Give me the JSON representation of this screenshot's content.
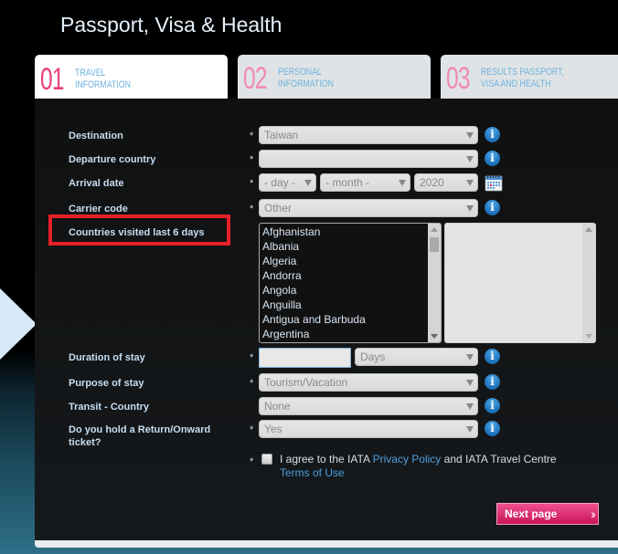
{
  "page": {
    "title": "Passport, Visa & Health"
  },
  "tabs": [
    {
      "num": "01",
      "line1": "Travel",
      "line2": "Information",
      "active": true
    },
    {
      "num": "02",
      "line1": "Personal",
      "line2": "Information",
      "active": false
    },
    {
      "num": "03",
      "line1": "Results Passport,",
      "line2": "Visa and Health",
      "active": false
    }
  ],
  "form": {
    "required_mark": "*",
    "destination": {
      "label": "Destination",
      "value": "Taiwan"
    },
    "departure": {
      "label": "Departure country",
      "value": ""
    },
    "arrival": {
      "label": "Arrival date",
      "day": "- day -",
      "month": "- month -",
      "year": "2020"
    },
    "carrier": {
      "label": "Carrier code",
      "value": "Other"
    },
    "countries_visited": {
      "label": "Countries visited last 6 days",
      "options": [
        "Afghanistan",
        "Albania",
        "Algeria",
        "Andorra",
        "Angola",
        "Anguilla",
        "Antigua and Barbuda",
        "Argentina"
      ],
      "selected": []
    },
    "duration": {
      "label": "Duration of stay",
      "value": "",
      "unit": "Days"
    },
    "purpose": {
      "label": "Purpose of stay",
      "value": "Tourism/Vacation"
    },
    "transit": {
      "label": "Transit - Country",
      "value": "None"
    },
    "return_ticket": {
      "label": "Do you hold a Return/Onward ticket?",
      "value": "Yes"
    },
    "agree": {
      "pre": "I agree to the IATA ",
      "privacy_link": "Privacy Policy",
      "mid": " and IATA Travel Centre ",
      "terms_link": "Terms of Use",
      "checked": false
    },
    "next_label": "Next page",
    "next_chevrons": "›››"
  },
  "icons": {
    "info_glyph": "i"
  },
  "colors": {
    "accent_pink": "#ec3d7c",
    "label_blue": "#c7def2",
    "link_blue": "#4b9fe0",
    "highlight_red": "#e8202a"
  }
}
